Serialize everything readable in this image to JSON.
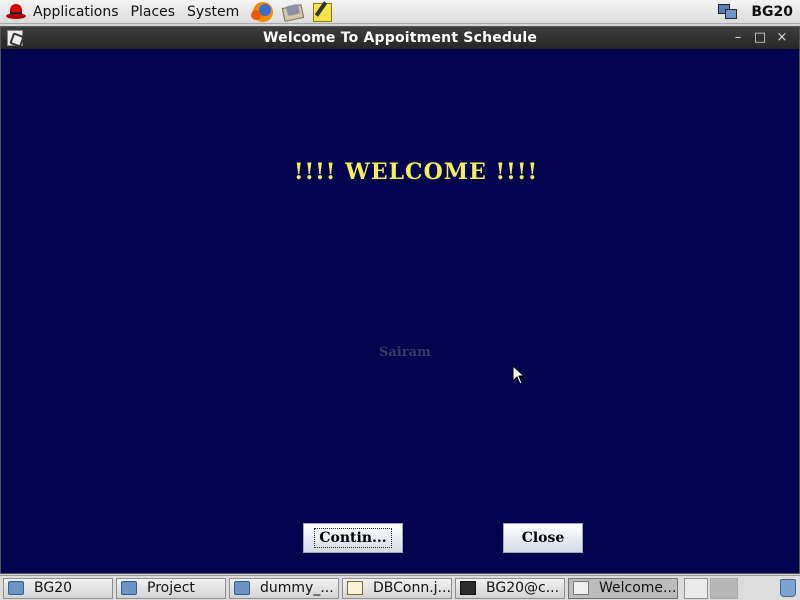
{
  "top_panel": {
    "menus": [
      "Applications",
      "Places",
      "System"
    ],
    "launchers": [
      "firefox-icon",
      "mail-icon",
      "note-icon"
    ],
    "host": "BG20"
  },
  "window": {
    "title": "Welcome To Appoitment Schedule",
    "controls": {
      "minimize": "–",
      "maximize": "□",
      "close": "×"
    },
    "background": "#02024f"
  },
  "content": {
    "heading": "!!!! WELCOME !!!!",
    "subtext": "Sairam",
    "continue_label": "Contin...",
    "close_label": "Close",
    "heading_color": "#f4f05a"
  },
  "taskbar": {
    "items": [
      {
        "label": "BG20",
        "icon": "folder-icon"
      },
      {
        "label": "Project",
        "icon": "folder-icon"
      },
      {
        "label": "dummy_...",
        "icon": "folder-icon"
      },
      {
        "label": "DBConn.j...",
        "icon": "editor-icon"
      },
      {
        "label": "BG20@c...",
        "icon": "terminal-icon"
      },
      {
        "label": "Welcome...",
        "icon": "java-icon",
        "active": true
      }
    ]
  }
}
